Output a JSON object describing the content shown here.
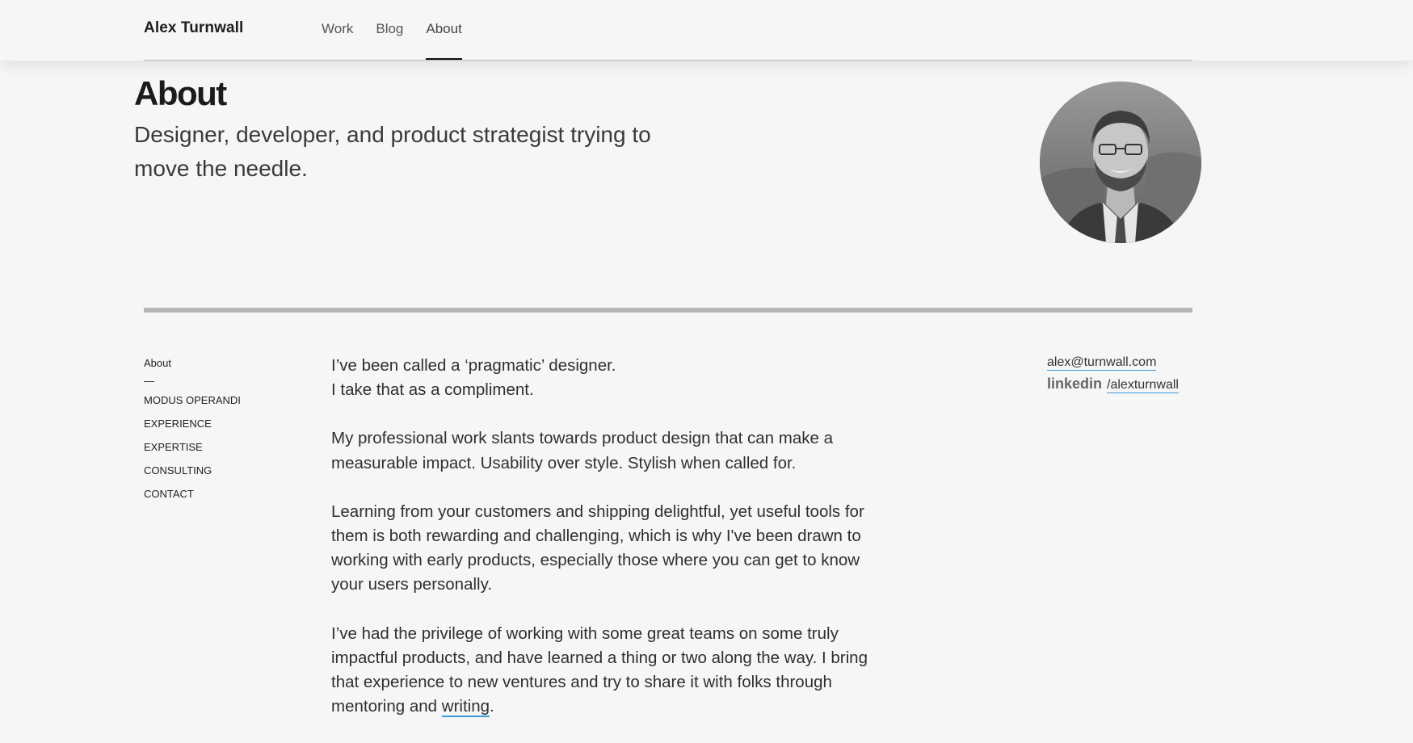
{
  "header": {
    "site_title": "Alex Turnwall",
    "nav": [
      {
        "label": "Work",
        "active": false
      },
      {
        "label": "Blog",
        "active": false
      },
      {
        "label": "About",
        "active": true
      }
    ]
  },
  "hero": {
    "title": "About",
    "subtitle": "Designer, developer, and product strategist trying to move the needle."
  },
  "side_nav": {
    "current": "About",
    "separator": "—",
    "items": [
      "MODUS OPERANDI",
      "EXPERIENCE",
      "EXPERTISE",
      "CONSULTING",
      "CONTACT"
    ]
  },
  "content": {
    "p1_line1": "I’ve been called a ‘pragmatic’ designer.",
    "p1_line2": "I take that as a compliment.",
    "p2": "My professional work slants towards product design that can make a measurable impact. Usability over style. Stylish when called for.",
    "p3": "Learning from your customers and shipping delightful, yet useful tools for them is both rewarding and challenging, which is why I've been drawn to working with early products, especially those where you can get to know your users personally.",
    "p4_text": "I’ve had the privilege of working with some great teams on some truly impactful products, and have learned a thing or two along the way. I bring that experience to new ventures and try to share it with folks through mentoring and",
    "p4_link": "writing",
    "p4_end": "."
  },
  "contact": {
    "email": "alex@turnwall.com",
    "linkedin_label": "linkedin",
    "linkedin_handle": "/alexturnwall"
  },
  "colors": {
    "background": "#f5f6f6",
    "link_underline": "#3b9bd6",
    "active_nav_indicator": "#111111"
  },
  "icons": {
    "avatar": "profile-photo"
  }
}
